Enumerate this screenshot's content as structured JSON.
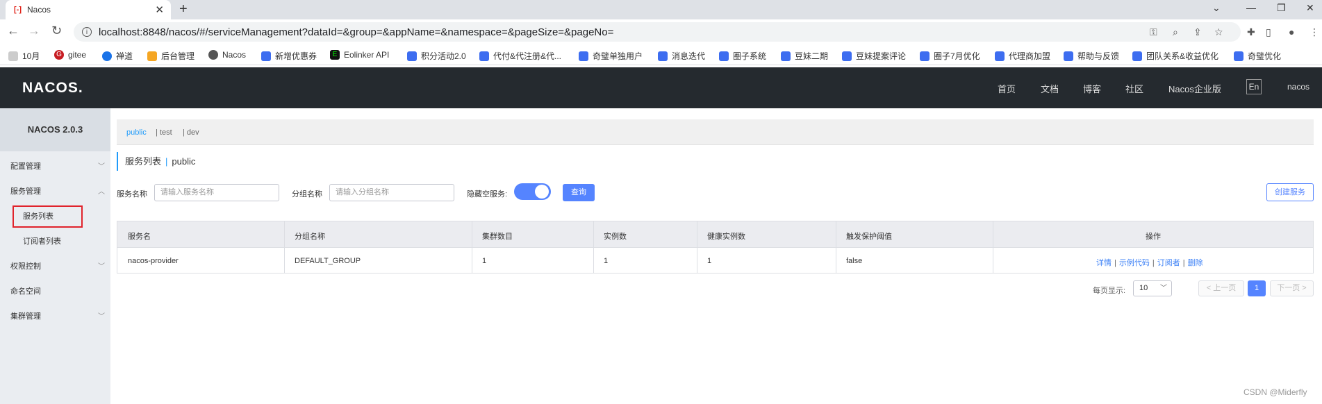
{
  "browser": {
    "tab_title": "Nacos",
    "tab_favicon": "[-]",
    "close_glyph": "✕",
    "newtab_glyph": "+",
    "url": "localhost:8848/nacos/#/serviceManagement?dataId=&group=&appName=&namespace=&pageSize=&pageNo=",
    "bookmarks": [
      "10月",
      "gitee",
      "禅道",
      "后台管理",
      "Nacos",
      "新增优惠券",
      "Eolinker API",
      "积分活动2.0",
      "代付&代注册&代...",
      "奇璧单独用户",
      "消息迭代",
      "圈子系统",
      "豆妹二期",
      "豆妹提案评论",
      "圈子7月优化",
      "代理商加盟",
      "帮助与反馈",
      "团队关系&收益优化",
      "奇璧优化"
    ]
  },
  "header": {
    "logo": "NACOS.",
    "nav": [
      "首页",
      "文档",
      "博客",
      "社区",
      "Nacos企业版"
    ],
    "lang": "En",
    "user": "nacos"
  },
  "sidebar": {
    "version": "NACOS 2.0.3",
    "items": [
      {
        "label": "配置管理"
      },
      {
        "label": "服务管理"
      },
      {
        "label": "服务列表"
      },
      {
        "label": "订阅者列表"
      },
      {
        "label": "权限控制"
      },
      {
        "label": "命名空间"
      },
      {
        "label": "集群管理"
      }
    ]
  },
  "namespaces": [
    "public",
    "| test",
    "| dev"
  ],
  "page": {
    "title": "服务列表",
    "title_sep": "|",
    "namespace": "public"
  },
  "filters": {
    "service_label": "服务名称",
    "service_placeholder": "请输入服务名称",
    "group_label": "分组名称",
    "group_placeholder": "请输入分组名称",
    "hide_empty_label": "隐藏空服务:",
    "hide_empty_on": true,
    "query": "查询",
    "create": "创建服务"
  },
  "table": {
    "columns": [
      "服务名",
      "分组名称",
      "集群数目",
      "实例数",
      "健康实例数",
      "触发保护阈值",
      "操作"
    ],
    "rows": [
      {
        "service": "nacos-provider",
        "group": "DEFAULT_GROUP",
        "clusters": "1",
        "instances": "1",
        "healthy": "1",
        "protect": "false",
        "ops": [
          "详情",
          "示例代码",
          "订阅者",
          "删除"
        ]
      }
    ]
  },
  "pager": {
    "label": "每页显示:",
    "page_size": "10",
    "prev": "< 上一页",
    "current": "1",
    "next": "下一页 >"
  },
  "watermark": "CSDN @Miderfly"
}
